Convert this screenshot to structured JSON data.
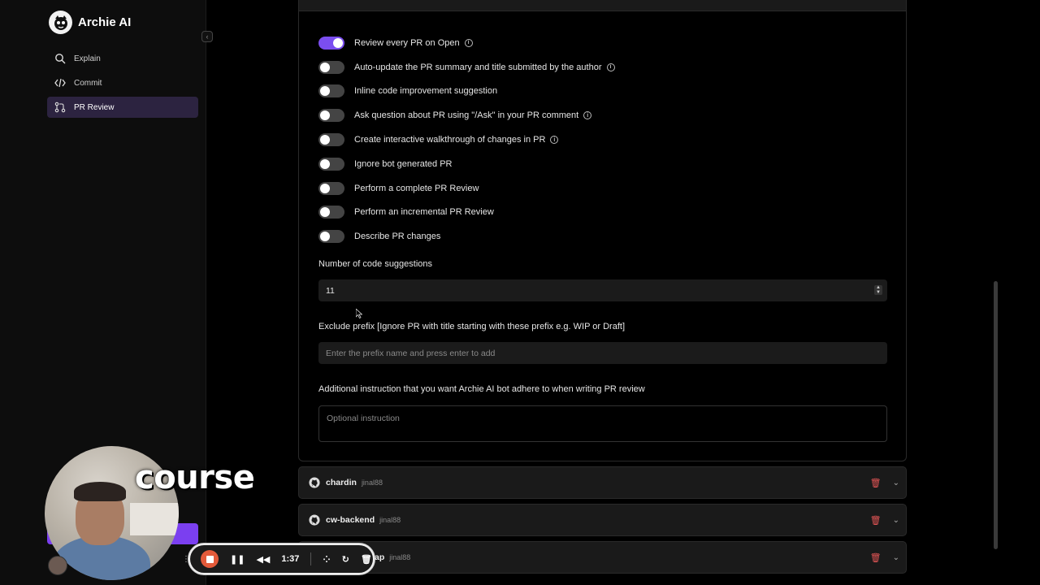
{
  "app": {
    "name": "Archie AI"
  },
  "sidebar": {
    "items": [
      {
        "label": "Explain",
        "icon": "search-icon",
        "active": false
      },
      {
        "label": "Commit",
        "icon": "code-icon",
        "active": false
      },
      {
        "label": "PR Review",
        "icon": "git-pull-request-icon",
        "active": true
      }
    ]
  },
  "settings": {
    "toggles": [
      {
        "label": "Review every PR on Open",
        "on": true,
        "info": true
      },
      {
        "label": "Auto-update the PR summary and title submitted by the author",
        "on": false,
        "info": true
      },
      {
        "label": "Inline code improvement suggestion",
        "on": false,
        "info": false
      },
      {
        "label": "Ask question about PR using \"/Ask\" in your PR comment",
        "on": false,
        "info": true
      },
      {
        "label": "Create interactive walkthrough of changes in PR",
        "on": false,
        "info": true
      },
      {
        "label": "Ignore bot generated PR",
        "on": false,
        "info": false
      },
      {
        "label": "Perform a complete PR Review",
        "on": false,
        "info": false
      },
      {
        "label": "Perform an incremental PR Review",
        "on": false,
        "info": false
      },
      {
        "label": "Describe PR changes",
        "on": false,
        "info": false
      }
    ],
    "code_suggestions": {
      "label": "Number of code suggestions",
      "value": "11"
    },
    "exclude_prefix": {
      "label": "Exclude prefix [Ignore PR with title starting with these prefix e.g. WIP or Draft]",
      "placeholder": "Enter the prefix name and press enter to add"
    },
    "additional_instruction": {
      "label": "Additional instruction that you want Archie AI bot adhere to when writing PR review",
      "placeholder": "Optional instruction"
    }
  },
  "repos": [
    {
      "name": "chardin",
      "owner": "jinal88"
    },
    {
      "name": "cw-backend",
      "owner": "jinal88"
    },
    {
      "name": "ap",
      "owner": "jinal88"
    }
  ],
  "overlay": {
    "caption": "course",
    "recorder": {
      "time": "1:37"
    }
  },
  "colors": {
    "accent": "#7b4ef0",
    "danger": "#e25555",
    "record": "#e35a3a"
  }
}
